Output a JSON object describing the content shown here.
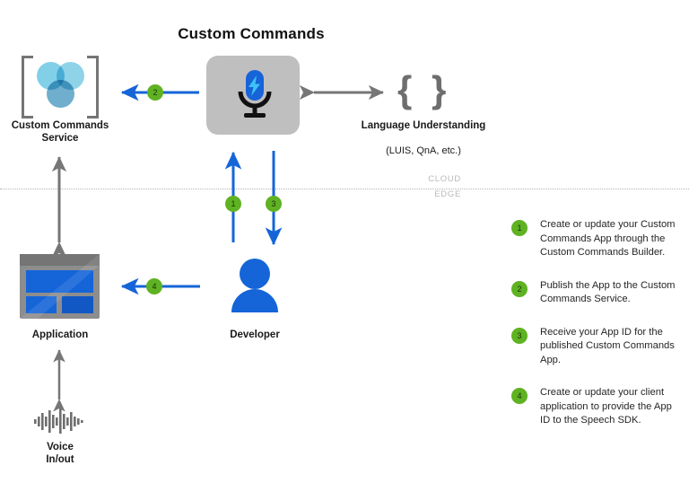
{
  "diagram": {
    "title": "Custom Commands",
    "boundary": {
      "upper_label": "CLOUD",
      "lower_label": "EDGE"
    },
    "nodes": {
      "custom_commands_service": {
        "label": "Custom Commands Service",
        "icon": "three-circles-brackets-icon"
      },
      "speech": {
        "label": "",
        "icon": "microphone-lightning-icon"
      },
      "language_understanding": {
        "label": "Language Understanding",
        "sublabel": "(LUIS, QnA, etc.)",
        "icon": "curly-braces-icon"
      },
      "application": {
        "label": "Application",
        "icon": "app-window-icon"
      },
      "developer": {
        "label": "Developer",
        "icon": "person-icon"
      },
      "voice": {
        "label": "Voice",
        "sublabel": "In/out",
        "icon": "waveform-icon"
      }
    },
    "connector_badges": {
      "one": "1",
      "two": "2",
      "three": "3",
      "four": "4"
    }
  },
  "legend": {
    "items": [
      {
        "number": "1",
        "text": "Create or update your Custom Commands App through the Custom Commands Builder."
      },
      {
        "number": "2",
        "text": "Publish the App to the Custom Commands Service."
      },
      {
        "number": "3",
        "text": "Receive your App ID for the published Custom Commands App."
      },
      {
        "number": "4",
        "text": "Create or update your client application to provide the App ID to the Speech SDK."
      }
    ]
  },
  "colors": {
    "accent_blue": "#1565d8",
    "badge_green": "#5fb222",
    "gray_arrow": "#767676",
    "speech_box": "#bfbfbf",
    "circle_light": "#82d0e8",
    "circle_dark": "#6fafcd",
    "divider": "#b5b5b5"
  }
}
